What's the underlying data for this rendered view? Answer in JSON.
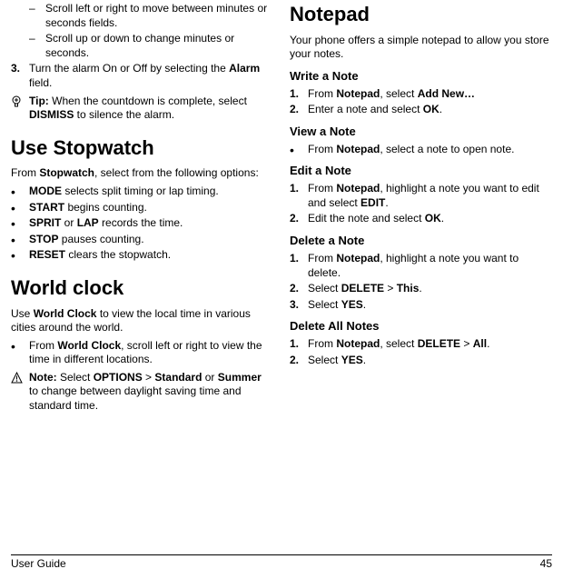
{
  "left": {
    "sub1": "Scroll left or right to move between minutes or seconds fields.",
    "sub2": "Scroll up or down to change minutes or seconds.",
    "step3_num": "3.",
    "step3_pre": "Turn the alarm On or Off by selecting the ",
    "step3_b": "Alarm",
    "step3_post": " field.",
    "tip_label": "Tip:",
    "tip_pre": " When the countdown is complete, select ",
    "tip_b": "DISMISS",
    "tip_post": " to silence the alarm.",
    "h_stopwatch": "Use Stopwatch",
    "sw_intro_pre": "From ",
    "sw_intro_b": "Stopwatch",
    "sw_intro_post": ", select from the following options:",
    "sw1_b": "MODE",
    "sw1_t": " selects split timing or lap timing.",
    "sw2_b": "START",
    "sw2_t": " begins counting.",
    "sw3_b1": "SPRIT",
    "sw3_mid": " or ",
    "sw3_b2": "LAP",
    "sw3_t": " records the time.",
    "sw4_b": "STOP",
    "sw4_t": " pauses counting.",
    "sw5_b": "RESET",
    "sw5_t": " clears the stopwatch.",
    "h_world": "World clock",
    "wc_intro_pre": "Use ",
    "wc_intro_b": "World Clock",
    "wc_intro_post": " to view the local time in various cities around the world.",
    "wc_b_pre": "From ",
    "wc_b_b": "World Clock",
    "wc_b_post": ", scroll left or right to view the time in different locations.",
    "note_label": "Note:",
    "note_pre": " Select ",
    "note_b1": "OPTIONS",
    "note_gt": " > ",
    "note_b2": "Standard",
    "note_or": " or ",
    "note_b3": "Summer",
    "note_post": " to change between daylight saving time and standard time."
  },
  "right": {
    "h_notepad": "Notepad",
    "np_intro": "Your phone offers a simple notepad to allow you store your notes.",
    "h_write": "Write a Note",
    "w1_num": "1.",
    "w1_pre": "From ",
    "w1_b1": "Notepad",
    "w1_mid": ", select ",
    "w1_b2": "Add New…",
    "w2_num": "2.",
    "w2_pre": "Enter a note and select ",
    "w2_b": "OK",
    "w2_post": ".",
    "h_view": "View a Note",
    "v_pre": "From ",
    "v_b": "Notepad",
    "v_post": ", select a note to open note.",
    "h_edit": "Edit a Note",
    "e1_num": "1.",
    "e1_pre": "From ",
    "e1_b1": "Notepad",
    "e1_mid": ", highlight a note you want to edit and select ",
    "e1_b2": "EDIT",
    "e1_post": ".",
    "e2_num": "2.",
    "e2_pre": "Edit the note and select ",
    "e2_b": "OK",
    "e2_post": ".",
    "h_del": "Delete a Note",
    "d1_num": "1.",
    "d1_pre": "From ",
    "d1_b": "Notepad",
    "d1_post": ", highlight a note you want to delete.",
    "d2_num": "2.",
    "d2_pre": "Select ",
    "d2_b1": "DELETE",
    "d2_gt": " > ",
    "d2_b2": "This",
    "d2_post": ".",
    "d3_num": "3.",
    "d3_pre": "Select ",
    "d3_b": "YES",
    "d3_post": ".",
    "h_delall": "Delete All Notes",
    "da1_num": "1.",
    "da1_pre": "From ",
    "da1_b1": "Notepad",
    "da1_mid": ", select ",
    "da1_b2": "DELETE",
    "da1_gt": " > ",
    "da1_b3": "All",
    "da1_post": ".",
    "da2_num": "2.",
    "da2_pre": "Select ",
    "da2_b": "YES",
    "da2_post": "."
  },
  "footer": {
    "left": "User Guide",
    "right": "45"
  }
}
